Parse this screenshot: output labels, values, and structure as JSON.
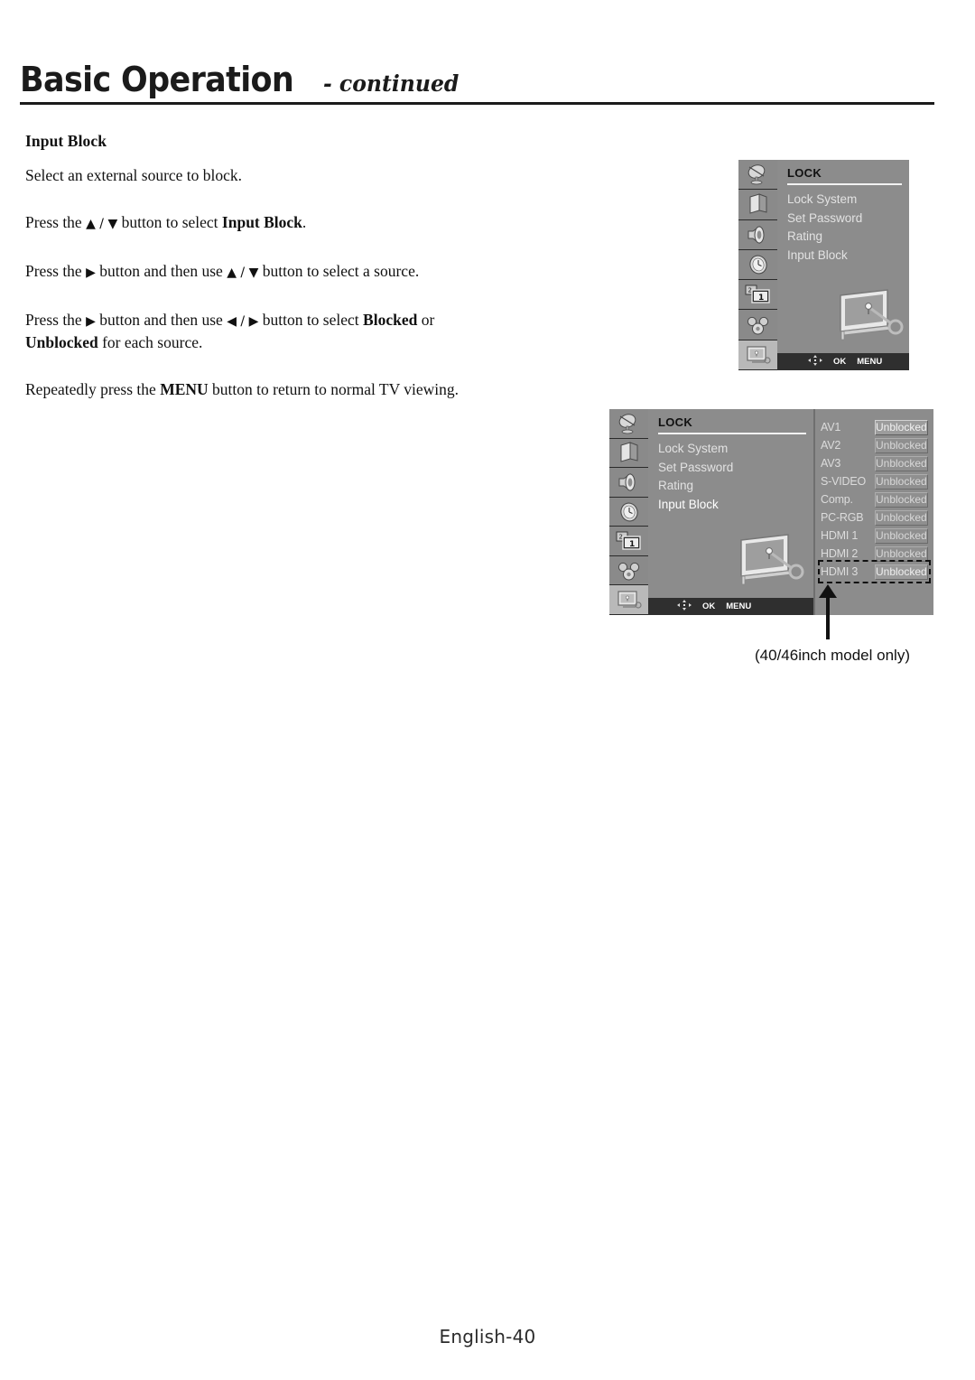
{
  "header": {
    "title": "Basic Operation",
    "subtitle": "- continued"
  },
  "content": {
    "section_heading": "Input Block",
    "paragraphs": [
      "Select an external source to block.",
      "Press the ▲ / ▼ button to select Input Block.",
      "Press the ▶ button and then use ▲ / ▼ button to select a source.",
      "Press the ▶ button and then use ◀ / ▶ button to select Blocked or Unblocked for each source.",
      "Repeatedly press the MENU button to return to normal TV viewing."
    ],
    "p1": "Select an external source to block.",
    "p2_a": "Press the ",
    "p2_arrows": "▲ / ▼",
    "p2_b": " button to select ",
    "p2_bold": "Input Block",
    "p2_c": ".",
    "p3_a": "Press the ",
    "p3_arrow1": "▶",
    "p3_b": " button and then use ",
    "p3_arrows": "▲ / ▼",
    "p3_c": " button to select a source.",
    "p4_a": "Press the ",
    "p4_arrow1": "▶",
    "p4_b": " button and then use ",
    "p4_arrows": "◀ / ▶",
    "p4_c": " button to select ",
    "p4_bold1": "Blocked",
    "p4_d": " or",
    "p4_bold2": "Unblocked",
    "p4_e": " for each source.",
    "p5_a": "Repeatedly press the ",
    "p5_bold": "MENU",
    "p5_b": " button to return to normal TV viewing."
  },
  "osd": {
    "rail_icons": [
      "satellite-dish-icon",
      "picture-panel-icon",
      "speaker-icon",
      "clock-icon",
      "pip-icon",
      "setup-gears-icon",
      "lock-tv-icon"
    ],
    "title": "LOCK",
    "menu_items": [
      "Lock System",
      "Set Password",
      "Rating",
      "Input Block"
    ],
    "bar": {
      "nav": "nav-4way-icon",
      "ok": "OK",
      "menu": "MENU"
    },
    "illustration": "tv-with-key-icon"
  },
  "source_list": {
    "rows": [
      {
        "label": "AV1",
        "value": "Unblocked"
      },
      {
        "label": "AV2",
        "value": "Unblocked"
      },
      {
        "label": "AV3",
        "value": "Unblocked"
      },
      {
        "label": "S-VIDEO",
        "value": "Unblocked"
      },
      {
        "label": "Comp.",
        "value": "Unblocked"
      },
      {
        "label": "PC-RGB",
        "value": "Unblocked"
      },
      {
        "label": "HDMI 1",
        "value": "Unblocked"
      },
      {
        "label": "HDMI 2",
        "value": "Unblocked"
      },
      {
        "label": "HDMI 3",
        "value": "Unblocked"
      }
    ],
    "highlighted_row": "HDMI 3"
  },
  "callout": {
    "text": "(40/46inch model only)"
  },
  "footer": {
    "page_label": "English-40"
  },
  "colors": {
    "osd_background": "#8c8c8c",
    "osd_rail": "#8a8a8a",
    "osd_rail_selected": "#b9b9b9",
    "osd_bar": "#2f2f2f",
    "text_dark": "#111111",
    "text_light": "#e9e9e9"
  }
}
